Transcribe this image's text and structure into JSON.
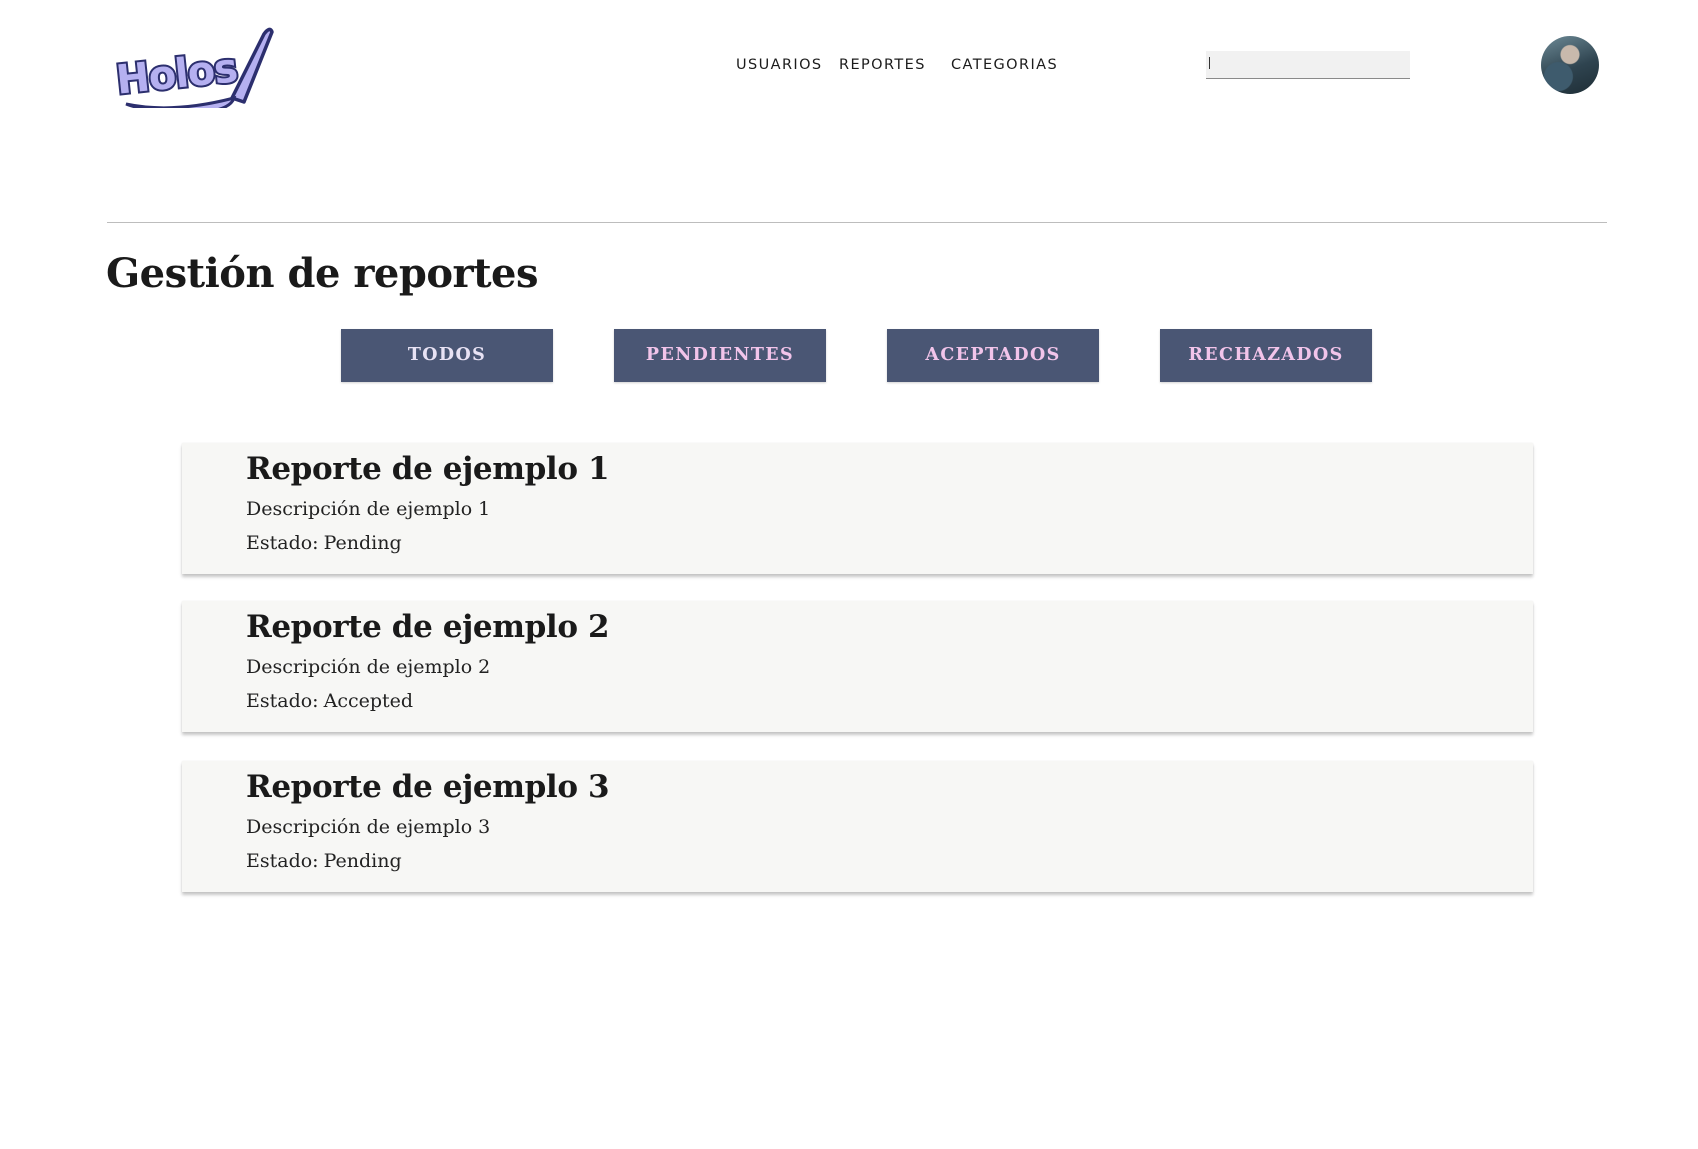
{
  "header": {
    "logo_text": "Holos",
    "nav": [
      {
        "label": "USUARIOS"
      },
      {
        "label": "REPORTES"
      },
      {
        "label": "CATEGORIAS"
      }
    ],
    "search": {
      "value": "",
      "placeholder": ""
    },
    "avatar_icon": "user-avatar-photo"
  },
  "main": {
    "title": "Gestión de reportes",
    "filters": [
      {
        "label": "TODOS"
      },
      {
        "label": "PENDIENTES"
      },
      {
        "label": "ACEPTADOS"
      },
      {
        "label": "RECHAZADOS"
      }
    ],
    "reports": [
      {
        "title": "Reporte de ejemplo 1",
        "description": "Descripción de ejemplo 1",
        "status_label": "Estado:",
        "status": "Pending"
      },
      {
        "title": "Reporte de ejemplo 2",
        "description": "Descripción de ejemplo 2",
        "status_label": "Estado:",
        "status": "Accepted"
      },
      {
        "title": "Reporte de ejemplo 3",
        "description": "Descripción de ejemplo 3",
        "status_label": "Estado:",
        "status": "Pending"
      }
    ]
  },
  "colors": {
    "button_bg": "#4a5674",
    "button_text": "#f2c4ea",
    "card_bg": "#f7f7f5",
    "logo_fill": "#b5b0f0",
    "logo_outline": "#2c2f6e"
  }
}
